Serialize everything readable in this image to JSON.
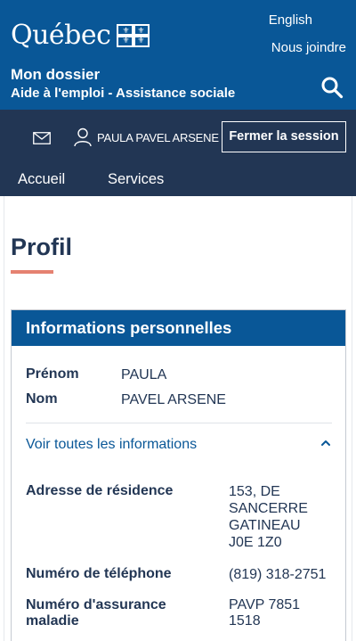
{
  "header": {
    "logo_text": "Québec",
    "lang_link": "English",
    "contact_link": "Nous joindre",
    "section_title": "Mon dossier",
    "program_title": "Aide à l'emploi - Assistance sociale"
  },
  "userbar": {
    "user_name": "PAULA PAVEL ARSENE",
    "logout_label": "Fermer la session"
  },
  "nav": {
    "items": [
      {
        "label": "Accueil"
      },
      {
        "label": "Services"
      }
    ]
  },
  "page": {
    "title": "Profil"
  },
  "card": {
    "title": "Informations personnelles",
    "prenom_label": "Prénom",
    "prenom_value": "PAULA",
    "nom_label": "Nom",
    "nom_value": "PAVEL ARSENE",
    "see_all_label": "Voir toutes les informations",
    "address_label": "Adresse de résidence",
    "address_lines": [
      "153, DE",
      "SANCERRE",
      "GATINEAU",
      "J0E 1Z0"
    ],
    "phone_label": "Numéro de téléphone",
    "phone_value": "(819) 318-2751",
    "health_label_lines": [
      "Numéro d'assurance",
      "maladie"
    ],
    "health_value_lines": [
      "PAVP 7851",
      "1518"
    ]
  },
  "colors": {
    "brand_blue": "#095797",
    "dark_navy": "#223654",
    "accent_underline": "#e58271"
  },
  "icons": [
    "quebec-flag-icon",
    "search-icon",
    "mail-icon",
    "user-icon",
    "chevron-up-icon"
  ]
}
